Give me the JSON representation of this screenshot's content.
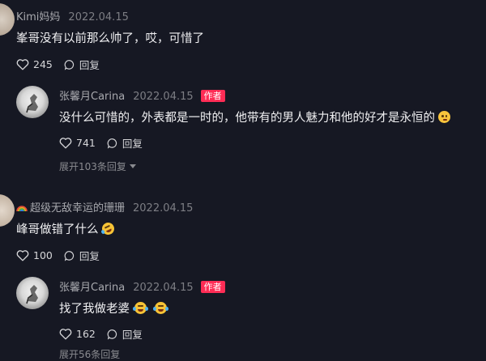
{
  "comments": [
    {
      "user": "Kimi妈妈",
      "date": "2022.04.15",
      "text": "峯哥没有以前那么帅了，哎，可惜了",
      "likes": "245",
      "reply_label": "回复"
    },
    {
      "user": "张馨月Carina",
      "date": "2022.04.15",
      "badge": "作者",
      "text": "没什么可惜的，外表都是一时的，他带有的男人魅力和他的好才是永恒的",
      "emoji": "thinking-emoji",
      "likes": "741",
      "reply_label": "回复",
      "expand": "展开103条回复"
    },
    {
      "user": "超级无敌幸运的珊珊",
      "user_prefix_icon": "rainbow-icon",
      "date": "2022.04.15",
      "text": "峰哥做错了什么",
      "emoji": "rofl-emoji",
      "likes": "100",
      "reply_label": "回复"
    },
    {
      "user": "张馨月Carina",
      "date": "2022.04.15",
      "badge": "作者",
      "text": "找了我做老婆",
      "emoji": "joy-emoji",
      "likes": "162",
      "reply_label": "回复",
      "expand": "展开56条回复"
    }
  ],
  "colors": {
    "background": "#161823",
    "badge": "#fe2c55",
    "muted": "#7d7e84"
  }
}
